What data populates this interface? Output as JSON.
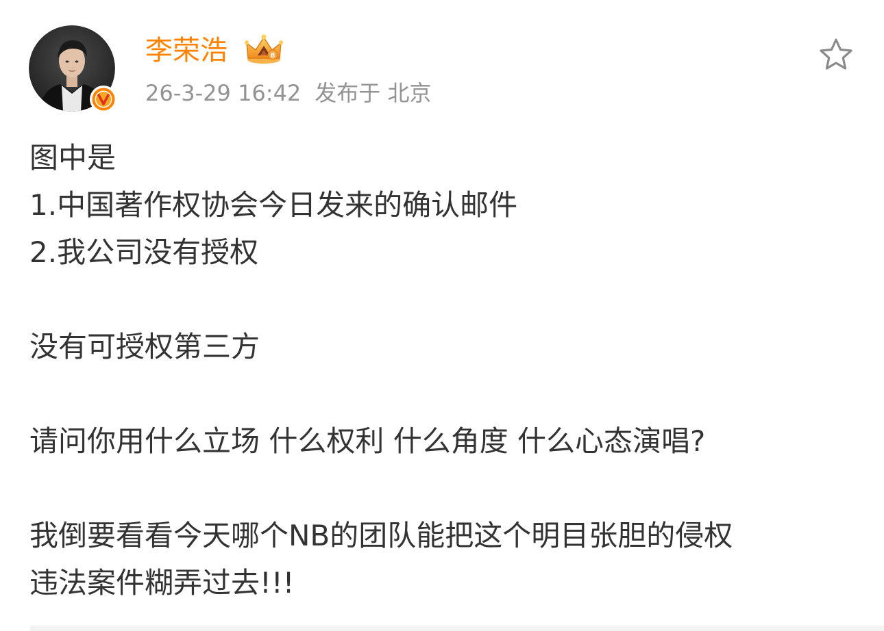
{
  "post": {
    "author": {
      "name": "李荣浩",
      "avatar_icon": "avatar-photo",
      "verified_icon": "verified-v-badge",
      "member_icon": "crown-icon",
      "name_color": "#ff8200"
    },
    "timestamp": "26-3-29 16:42",
    "location": "发布于 北京",
    "favorite_icon": "star-outline-icon",
    "content": [
      "图中是",
      "1.中国著作权协会今日发来的确认邮件",
      "2.我公司没有授权",
      "",
      "没有可授权第三方",
      "",
      "请问你用什么立场 什么权利 什么角度 什么心态演唱?",
      "",
      "我倒要看看今天哪个NB的团队能把这个明目张胆的侵权",
      "违法案件糊弄过去!!!"
    ]
  }
}
